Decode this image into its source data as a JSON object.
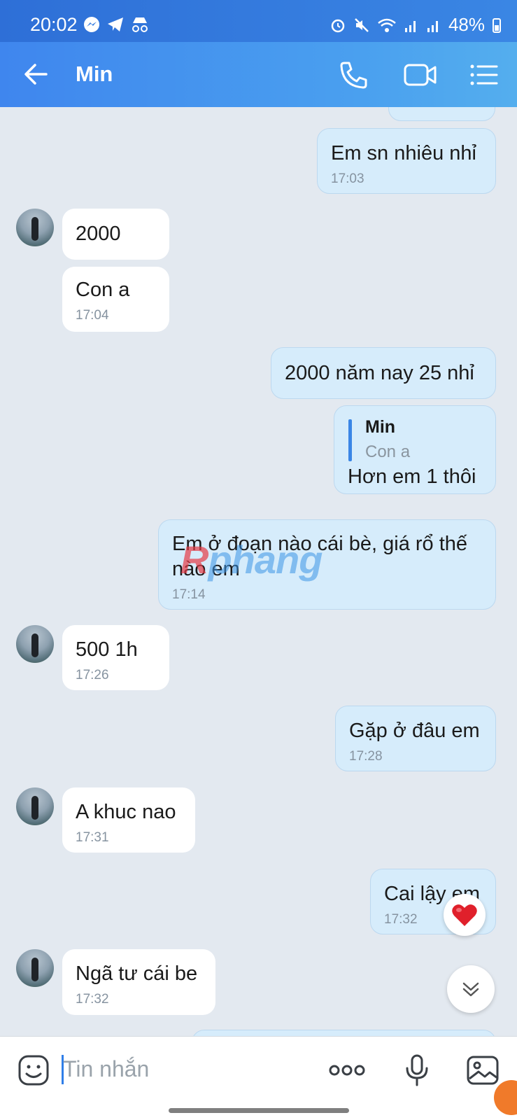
{
  "status_bar": {
    "time": "20:02",
    "battery": "48%"
  },
  "header": {
    "title": "Min"
  },
  "messages": [
    {
      "text": "Em sn nhiêu nhỉ",
      "time": "17:03"
    },
    {
      "text": "2000"
    },
    {
      "text": "Con a",
      "time": "17:04"
    },
    {
      "text": "2000 năm nay 25 nhỉ"
    },
    {
      "quote_name": "Min",
      "quote_text": "Con a",
      "text": "Hơn em 1 thôi"
    },
    {
      "text_line1": "Em ở đoạn nào cái bè, giá rổ thế",
      "text_line2": "nào em",
      "time": "17:14"
    },
    {
      "text": "500 1h",
      "time": "17:26"
    },
    {
      "text": "Gặp ở đâu em",
      "time": "17:28"
    },
    {
      "text": "A khuc nao",
      "time": "17:31"
    },
    {
      "text": "Cai lậy em",
      "time": "17:32"
    },
    {
      "text": "Ngã tư cái be",
      "time": "17:32"
    }
  ],
  "watermark": {
    "first": "R",
    "rest": "phang"
  },
  "input": {
    "placeholder": "Tin nhắn"
  },
  "colors": {
    "header": "#4a98ee",
    "outgoing_bubble": "#d6ecfb",
    "incoming_bubble": "#ffffff",
    "chat_bg": "#e3e9f0"
  },
  "icons": [
    "back-arrow-icon",
    "phone-icon",
    "video-icon",
    "menu-icon",
    "emoji-icon",
    "more-icon",
    "microphone-icon",
    "image-icon",
    "heart-icon",
    "chevron-down-icon"
  ]
}
